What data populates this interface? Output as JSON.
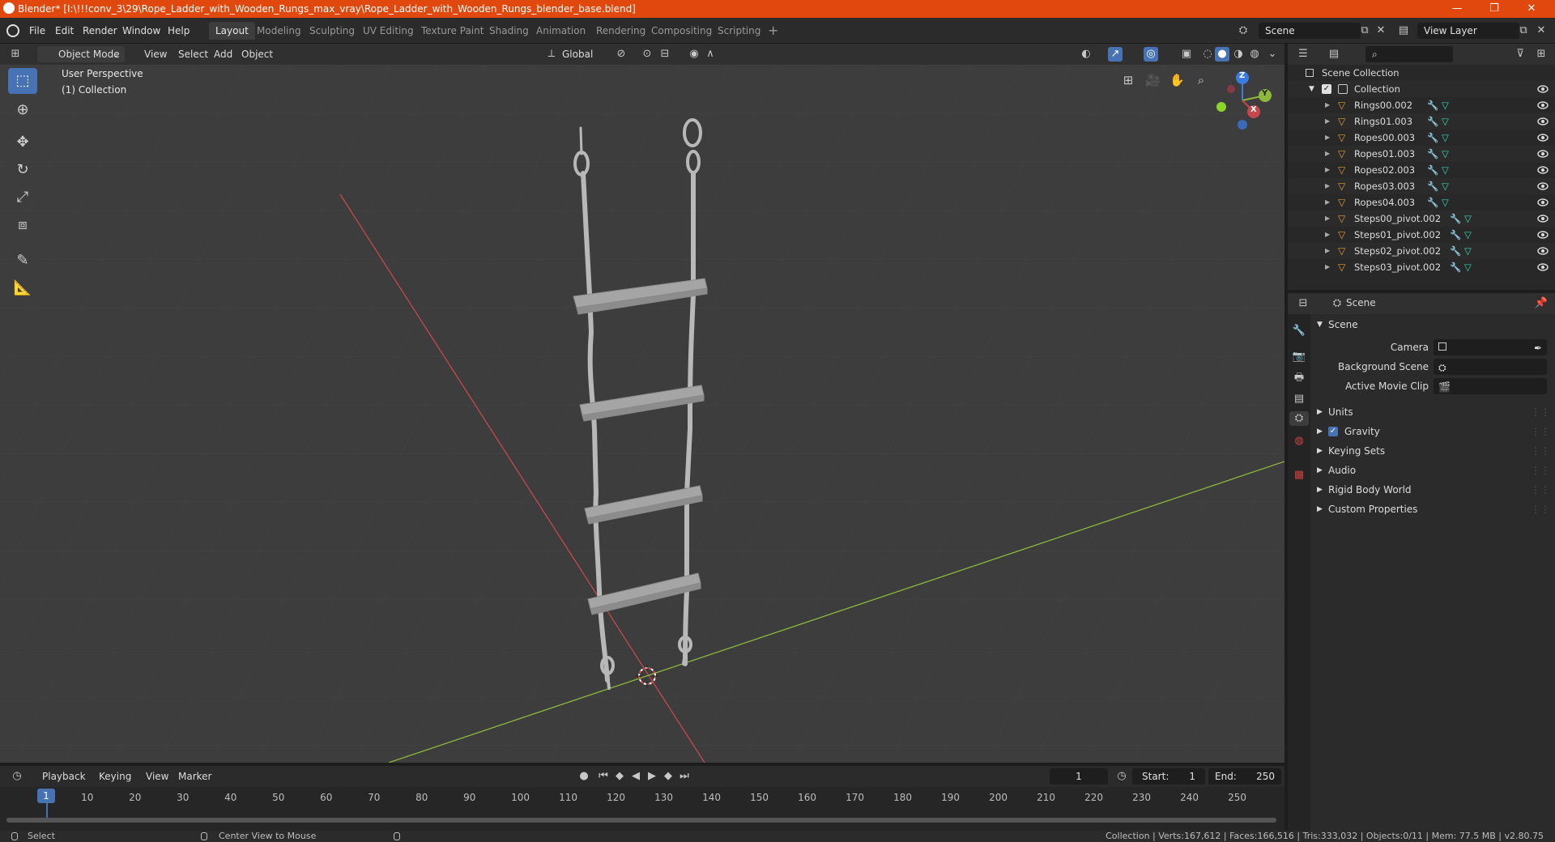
{
  "title_bar": {
    "title": "Blender* [I:\\!!!conv_3\\29\\Rope_Ladder_with_Wooden_Rungs_max_vray\\Rope_Ladder_with_Wooden_Rungs_blender_base.blend]",
    "minimize": "—",
    "maximize": "❐",
    "close": "✕"
  },
  "menu": {
    "file": "File",
    "edit": "Edit",
    "render": "Render",
    "window": "Window",
    "help": "Help"
  },
  "workspaces": [
    "Layout",
    "Modeling",
    "Sculpting",
    "UV Editing",
    "Texture Paint",
    "Shading",
    "Animation",
    "Rendering",
    "Compositing",
    "Scripting"
  ],
  "active_workspace": "Layout",
  "scene_selector": "Scene",
  "view_layer_selector": "View Layer",
  "viewport_header": {
    "mode": "Object Mode",
    "view": "View",
    "select": "Select",
    "add": "Add",
    "object": "Object",
    "orientation": "Global"
  },
  "viewport": {
    "perspective_label": "User Perspective",
    "collection_label": "(1) Collection",
    "gizmo": {
      "x": "X",
      "y": "Y",
      "z": "Z"
    }
  },
  "outliner": {
    "scene_collection": "Scene Collection",
    "collection": "Collection",
    "items": [
      "Rings00.002",
      "Rings01.003",
      "Ropes00.003",
      "Ropes01.003",
      "Ropes02.003",
      "Ropes03.003",
      "Ropes04.003",
      "Steps00_pivot.002",
      "Steps01_pivot.002",
      "Steps02_pivot.002",
      "Steps03_pivot.002"
    ]
  },
  "properties": {
    "header": "Scene",
    "panel_title": "Scene",
    "camera_label": "Camera",
    "background_scene_label": "Background Scene",
    "active_movie_clip_label": "Active Movie Clip",
    "sections": [
      "Units",
      "Gravity",
      "Keying Sets",
      "Audio",
      "Rigid Body World",
      "Custom Properties"
    ],
    "gravity_checked": true
  },
  "timeline": {
    "playback": "Playback",
    "keying": "Keying",
    "view": "View",
    "marker": "Marker",
    "current_frame": "1",
    "start_label": "Start:",
    "start": "1",
    "end_label": "End:",
    "end": "250",
    "ticks": [
      "1",
      "10",
      "20",
      "30",
      "40",
      "50",
      "60",
      "70",
      "80",
      "90",
      "100",
      "110",
      "120",
      "130",
      "140",
      "150",
      "160",
      "170",
      "180",
      "190",
      "200",
      "210",
      "220",
      "230",
      "240",
      "250"
    ]
  },
  "status_bar": {
    "select": "Select",
    "center_view": "Center View to Mouse",
    "stats": "Collection | Verts:167,612 | Faces:166,516 | Tris:333,032 | Objects:0/11 | Mem: 77.5 MB | v2.80.75"
  },
  "colors": {
    "accent": "#4772b3",
    "title_bar": "#e0480e",
    "axis_x": "#c8474c",
    "axis_y": "#8cb83c",
    "axis_z": "#3a7be0",
    "mesh_icon": "#e8983a",
    "modifier_icon": "#6aa8ff",
    "data_icon": "#34d8b0"
  }
}
